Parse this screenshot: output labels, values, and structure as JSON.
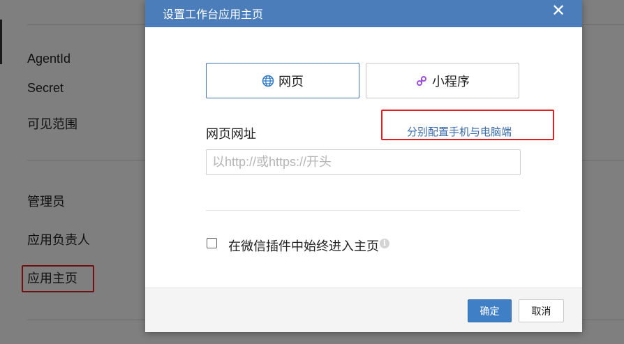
{
  "background": {
    "labels": {
      "agentid": "AgentId",
      "secret": "Secret",
      "visible_range": "可见范围",
      "admin": "管理员",
      "app_owner": "应用负责人",
      "app_homepage": "应用主页"
    }
  },
  "dialog": {
    "title": "设置工作台应用主页",
    "close_icon": "close-icon",
    "segments": [
      {
        "label": "网页",
        "icon": "globe-icon",
        "active": true
      },
      {
        "label": "小程序",
        "icon": "mini-program-icon",
        "active": false
      }
    ],
    "url_field": {
      "label": "网页网址",
      "placeholder": "以http://或https://开头",
      "value": ""
    },
    "split_link": "分别配置手机与电脑端",
    "checkbox": {
      "label": "在微信插件中始终进入主页",
      "checked": false,
      "info_icon": "info-icon"
    },
    "buttons": {
      "ok": "确定",
      "cancel": "取消"
    }
  },
  "colors": {
    "header": "#4a7db9",
    "primary_button": "#3f7fc5",
    "link": "#3a6aa8",
    "annotation": "#e02020",
    "mini_program_icon": "#9b4fd6"
  }
}
